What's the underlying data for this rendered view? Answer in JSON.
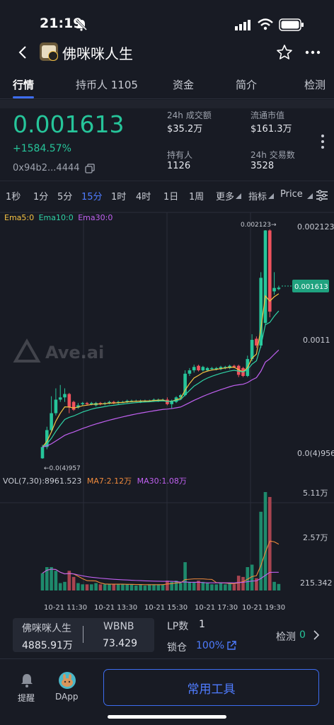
{
  "status": {
    "time": "21:19"
  },
  "header": {
    "title": "佛咪咪人生"
  },
  "tabs": [
    {
      "label": "行情"
    },
    {
      "label": "持币人 1105"
    },
    {
      "label": "资金"
    },
    {
      "label": "简介"
    },
    {
      "label": "检测"
    }
  ],
  "price": {
    "value": "0.001613",
    "change": "+1584.57%",
    "address": "0x94b2...4444"
  },
  "stats": {
    "vol_label": "24h 成交额",
    "vol_value": "$35.2万",
    "mcap_label": "流通市值",
    "mcap_value": "$161.3万",
    "holders_label": "持有人",
    "holders_value": "1126",
    "tx_label": "24h 交易数",
    "tx_value": "3528"
  },
  "intervals": [
    "1秒",
    "1分",
    "5分",
    "15分",
    "1时",
    "4时",
    "1日",
    "1周",
    "更多",
    "指标",
    "Price"
  ],
  "active_interval": "15分",
  "colors": {
    "up": "#26c59a",
    "down": "#f0525d",
    "ema5": "#f5c242",
    "ema10": "#2fd3a6",
    "ema30": "#c060f0",
    "accent": "#3d6df0"
  },
  "chart": {
    "ema_legend": {
      "ema5": "Ema5:0",
      "ema10": "Ema10:0",
      "ema30": "Ema30:0"
    },
    "y_labels": [
      "0.002123",
      "0.0011",
      "0.0(4)956"
    ],
    "high_label": "0.002123→",
    "low_label": "←0.0(4)957",
    "current_tag": "0.001613",
    "watermark": "Ave.ai",
    "vol_legend": {
      "vol": "VOL(7,30):8961.523",
      "ma7": "MA7:2.12万",
      "ma30": "MA30:1.08万"
    },
    "vol_y_labels": [
      "5.11万",
      "2.57万",
      "215.342"
    ],
    "x_labels": [
      "10-21 11:30",
      "10-21 13:30",
      "10-21 15:30",
      "10-21 17:30",
      "10-21 19:30"
    ]
  },
  "chart_data": {
    "type": "candlestick",
    "price_ylim": [
      "0.0(4)956",
      "0.002123"
    ],
    "candles": [
      {
        "dir": "up",
        "o": 0.0001,
        "c": 0.0002,
        "h": 0.00022,
        "l": 9.57e-05
      },
      {
        "dir": "up",
        "o": 0.0002,
        "c": 0.00035,
        "h": 0.00038,
        "l": 0.00018
      },
      {
        "dir": "up",
        "o": 0.00035,
        "c": 0.0005,
        "h": 0.00065,
        "l": 0.00033
      },
      {
        "dir": "up",
        "o": 0.0005,
        "c": 0.00062,
        "h": 0.00072,
        "l": 0.00048
      },
      {
        "dir": "up",
        "o": 0.00062,
        "c": 0.00064,
        "h": 0.00075,
        "l": 0.0006
      },
      {
        "dir": "up",
        "o": 0.00064,
        "c": 0.00067,
        "h": 0.00072,
        "l": 0.0006
      },
      {
        "dir": "down",
        "o": 0.00067,
        "c": 0.00055,
        "h": 0.00068,
        "l": 0.0005
      },
      {
        "dir": "down",
        "o": 0.0006,
        "c": 0.00053,
        "h": 0.00061,
        "l": 0.00052
      },
      {
        "dir": "up",
        "o": 0.00055,
        "c": 0.00057,
        "h": 0.00059,
        "l": 0.00054
      },
      {
        "dir": "up",
        "o": 0.00058,
        "c": 0.00059,
        "h": 0.0006,
        "l": 0.00057
      },
      {
        "dir": "down",
        "o": 0.00059,
        "c": 0.00058,
        "h": 0.0006,
        "l": 0.00057
      },
      {
        "dir": "up",
        "o": 0.00058,
        "c": 0.00059,
        "h": 0.0006,
        "l": 0.00057
      },
      {
        "dir": "up",
        "o": 0.00057,
        "c": 0.00059,
        "h": 0.0006,
        "l": 0.00056
      },
      {
        "dir": "down",
        "o": 0.00059,
        "c": 0.00058,
        "h": 0.0006,
        "l": 0.00057
      },
      {
        "dir": "up",
        "o": 0.00058,
        "c": 0.00059,
        "h": 0.0006,
        "l": 0.00057
      },
      {
        "dir": "up",
        "o": 0.00059,
        "c": 0.0006,
        "h": 0.00061,
        "l": 0.00058
      },
      {
        "dir": "down",
        "o": 0.0006,
        "c": 0.00059,
        "h": 0.00061,
        "l": 0.00058
      },
      {
        "dir": "up",
        "o": 0.00059,
        "c": 0.0006,
        "h": 0.00061,
        "l": 0.00058
      },
      {
        "dir": "up",
        "o": 0.00059,
        "c": 0.0006,
        "h": 0.00061,
        "l": 0.00059
      },
      {
        "dir": "up",
        "o": 0.0006,
        "c": 0.00061,
        "h": 0.00062,
        "l": 0.00059
      },
      {
        "dir": "up",
        "o": 0.0006,
        "c": 0.00061,
        "h": 0.00062,
        "l": 0.0006
      },
      {
        "dir": "up",
        "o": 0.00061,
        "c": 0.00061,
        "h": 0.00062,
        "l": 0.0006
      },
      {
        "dir": "up",
        "o": 0.0006,
        "c": 0.00061,
        "h": 0.00062,
        "l": 0.00059
      },
      {
        "dir": "up",
        "o": 0.00061,
        "c": 0.00061,
        "h": 0.00062,
        "l": 0.0006
      },
      {
        "dir": "up",
        "o": 0.0006,
        "c": 0.00061,
        "h": 0.00062,
        "l": 0.0006
      },
      {
        "dir": "up",
        "o": 0.00061,
        "c": 0.00062,
        "h": 0.00063,
        "l": 0.0006
      },
      {
        "dir": "up",
        "o": 0.00061,
        "c": 0.00062,
        "h": 0.00063,
        "l": 0.0006
      },
      {
        "dir": "up",
        "o": 0.00061,
        "c": 0.00062,
        "h": 0.00063,
        "l": 0.00061
      },
      {
        "dir": "down",
        "o": 0.00062,
        "c": 0.00058,
        "h": 0.00064,
        "l": 0.00057
      },
      {
        "dir": "up",
        "o": 0.00058,
        "c": 0.00061,
        "h": 0.00062,
        "l": 0.00054
      },
      {
        "dir": "up",
        "o": 0.0006,
        "c": 0.00064,
        "h": 0.00065,
        "l": 0.00059
      },
      {
        "dir": "up",
        "o": 0.00064,
        "c": 0.00066,
        "h": 0.00067,
        "l": 0.00063
      },
      {
        "dir": "up",
        "o": 0.00066,
        "c": 0.00085,
        "h": 0.00088,
        "l": 0.00065
      },
      {
        "dir": "up",
        "o": 0.00085,
        "c": 0.00088,
        "h": 0.0009,
        "l": 0.00083
      },
      {
        "dir": "up",
        "o": 0.00088,
        "c": 0.00091,
        "h": 0.00093,
        "l": 0.00086
      },
      {
        "dir": "down",
        "o": 0.00092,
        "c": 0.00088,
        "h": 0.00093,
        "l": 0.00087
      },
      {
        "dir": "up",
        "o": 0.00088,
        "c": 0.00091,
        "h": 0.00092,
        "l": 0.00087
      },
      {
        "dir": "up",
        "o": 0.00088,
        "c": 0.0009,
        "h": 0.00091,
        "l": 0.00087
      },
      {
        "dir": "up",
        "o": 0.00089,
        "c": 0.0009,
        "h": 0.00091,
        "l": 0.00088
      },
      {
        "dir": "up",
        "o": 0.00089,
        "c": 0.0009,
        "h": 0.00091,
        "l": 0.00088
      },
      {
        "dir": "up",
        "o": 0.00089,
        "c": 0.00091,
        "h": 0.00092,
        "l": 0.00088
      },
      {
        "dir": "up",
        "o": 0.0009,
        "c": 0.00091,
        "h": 0.00092,
        "l": 0.00089
      },
      {
        "dir": "up",
        "o": 0.0009,
        "c": 0.00092,
        "h": 0.00093,
        "l": 0.00089
      },
      {
        "dir": "down",
        "o": 0.00092,
        "c": 0.00091,
        "h": 0.00093,
        "l": 0.0009
      },
      {
        "dir": "down",
        "o": 0.00092,
        "c": 0.00084,
        "h": 0.00093,
        "l": 0.00082
      },
      {
        "dir": "down",
        "o": 0.0009,
        "c": 0.00083,
        "h": 0.00091,
        "l": 0.00082
      },
      {
        "dir": "up",
        "o": 0.00083,
        "c": 0.00098,
        "h": 0.00101,
        "l": 0.00082
      },
      {
        "dir": "up",
        "o": 0.00098,
        "c": 0.00115,
        "h": 0.0012,
        "l": 0.00096
      },
      {
        "dir": "down",
        "o": 0.00116,
        "c": 0.0011,
        "h": 0.00118,
        "l": 0.00108
      },
      {
        "dir": "up",
        "o": 0.0011,
        "c": 0.0017,
        "h": 0.00175,
        "l": 0.00108
      },
      {
        "dir": "up",
        "o": 0.0013,
        "c": 0.00212,
        "h": 0.002123,
        "l": 0.00128
      },
      {
        "dir": "down",
        "o": 0.00212,
        "c": 0.0014,
        "h": 0.00213,
        "l": 0.00135
      },
      {
        "dir": "up",
        "o": 0.00158,
        "c": 0.00161,
        "h": 0.00175,
        "l": 0.00155
      },
      {
        "dir": "up",
        "o": 0.0016,
        "c": 0.001613,
        "h": 0.00163,
        "l": 0.00159
      }
    ],
    "volume_ylim": [
      "215.342",
      "5.11万"
    ]
  }
}
